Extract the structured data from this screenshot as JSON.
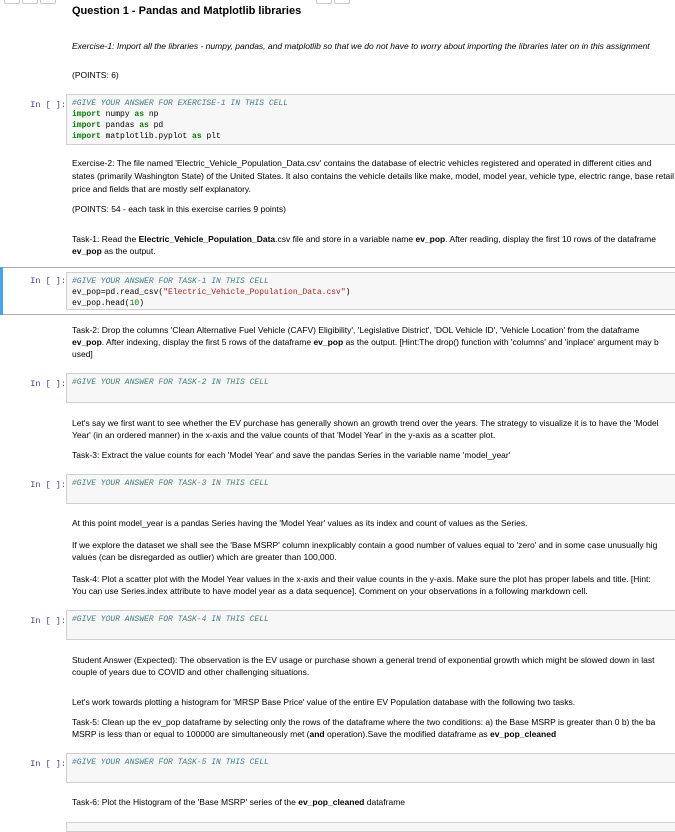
{
  "notebook": {
    "title": "Question 1 - Pandas and Matplotlib libraries",
    "exercise1": {
      "text": "Exercise-1: Import all the libraries - numpy, pandas, and matplotlib so that we do not have to worry about importing the libraries later on in this assignment",
      "points": "(POINTS: 6)"
    },
    "prompt": "In [ ]:",
    "cell1": {
      "comment": "#GIVE YOUR ANSWER FOR EXERCISE-1 IN THIS CELL",
      "line1_kw": "import",
      "line1_rest": " numpy ",
      "line1_as": "as",
      "line1_alias": " np",
      "line2_kw": "import",
      "line2_rest": " pandas ",
      "line2_as": "as",
      "line2_alias": " pd",
      "line3_kw": "import",
      "line3_rest": " matplotlib.pyplot ",
      "line3_as": "as",
      "line3_alias": " plt"
    },
    "exercise2": {
      "text": "Exercise-2: The file named 'Electric_Vehicle_Population_Data.csv' contains the database of electric vehicles registered and operated in different cities and states (primarily Washington State) of the United States. It also contains the vehicle details like make, model, model year, vehicle type, electric range, base retail price and fields that are mostly self explanatory.",
      "points": "(POINTS: 54 - each task in this exercise carries 9 points)"
    },
    "task1": {
      "pre": "Task-1: Read the ",
      "file": "Electric_Vehicle_Population_Data",
      "mid": ".csv file and store in a variable name ",
      "var": "ev_pop",
      "post": ". After reading, display the first 10 rows of the dataframe",
      "line2_var": "ev_pop",
      "line2_post": " as the output."
    },
    "cell2": {
      "comment": "#GIVE YOUR ANSWER FOR TASK-1 IN THIS CELL",
      "line1_code": "ev_pop=pd.read_csv(",
      "line1_str": "\"Electric_Vehicle_Population_Data.csv\"",
      "line1_end": ")",
      "line2_code": "ev_pop.head(",
      "line2_num": "10",
      "line2_end": ")"
    },
    "task2": {
      "line1": "Task-2: Drop the columns 'Clean Alternative Fuel Vehicle (CAFV) Eligibility', 'Legislative District', 'DOL Vehicle ID', 'Vehicle Location' from the dataframe",
      "line2_var": "ev_pop",
      "line2_mid": ". After indexing, display the first 5 rows of the dataframe ",
      "line2_var2": "ev_pop",
      "line2_post": " as the output. [Hint:The drop() function with 'columns' and 'inplace' argument may b",
      "line3": "used]"
    },
    "cell3": {
      "comment": "#GIVE YOUR ANSWER FOR TASK-2 IN THIS CELL"
    },
    "intro3": {
      "line1": "Let's say we first want to see whether the EV purchase has generally shown an growth trend over the years. The strategy to visualize it is to have the 'Model",
      "line2": "Year' (in an ordered manner) in the x-axis and the value counts of that 'Model Year' in the y-axis as a scatter plot."
    },
    "task3": {
      "text": "Task-3: Extract the value counts for each 'Model Year' and save the pandas Series in the variable name 'model_year'"
    },
    "cell4": {
      "comment": "#GIVE YOUR ANSWER FOR TASK-3 IN THIS CELL"
    },
    "intro4": {
      "line1": "At this point model_year is a pandas Series having the 'Model Year' values as its index and count of values as the Series.",
      "line2": "If we explore the dataset we shall see the 'Base MSRP' column inexplicably contain a good number of values equal to 'zero' and in some case unusually hig",
      "line3": "values (can be disregarded as outlier) which are greater than 100,000."
    },
    "task4": {
      "line1": "Task-4: Plot a scatter plot with the Model Year values in the x-axis and their value counts in the y-axis. Make sure the plot has proper labels and title. [Hint:",
      "line2": "You can use Series.index attribute to have model year as a data sequence]. Comment on your observations in a following markdown cell."
    },
    "cell5": {
      "comment": "#GIVE YOUR ANSWER FOR TASK-4 IN THIS CELL"
    },
    "answer4": {
      "line1": "Student Answer (Expected): The observation is the EV usage or purchase shown a general trend of exponential growth which might be slowed down in last",
      "line2": "couple of years due to COVID and other challenging situations."
    },
    "intro5": {
      "text": "Let's work towards plotting a histogram for 'MRSP Base Price' value of the entire EV Population database with the following two tasks."
    },
    "task5": {
      "line1": "Task-5: Clean up the ev_pop dataframe by selecting only the rows of the dataframe where the two conditions: a) the Base MSRP is greater than 0 b) the ba",
      "line2_pre": "MSRP is less than or equal to 100000 are simultaneously met (",
      "line2_and": "and",
      "line2_mid": " operation).Save the modified dataframe as ",
      "line2_var": "ev_pop_cleaned"
    },
    "cell6": {
      "comment": "#GIVE YOUR ANSWER FOR TASK-5 IN THIS CELL"
    },
    "task6": {
      "pre": "Task-6: Plot the Histogram of the 'Base MSRP' series of the ",
      "var": "ev_pop_cleaned",
      "post": " dataframe"
    },
    "colors": {
      "prompt": "#303f9f",
      "comment": "#408080",
      "keyword": "#008000",
      "string": "#ba2121",
      "selection": "#42a5f5"
    }
  }
}
